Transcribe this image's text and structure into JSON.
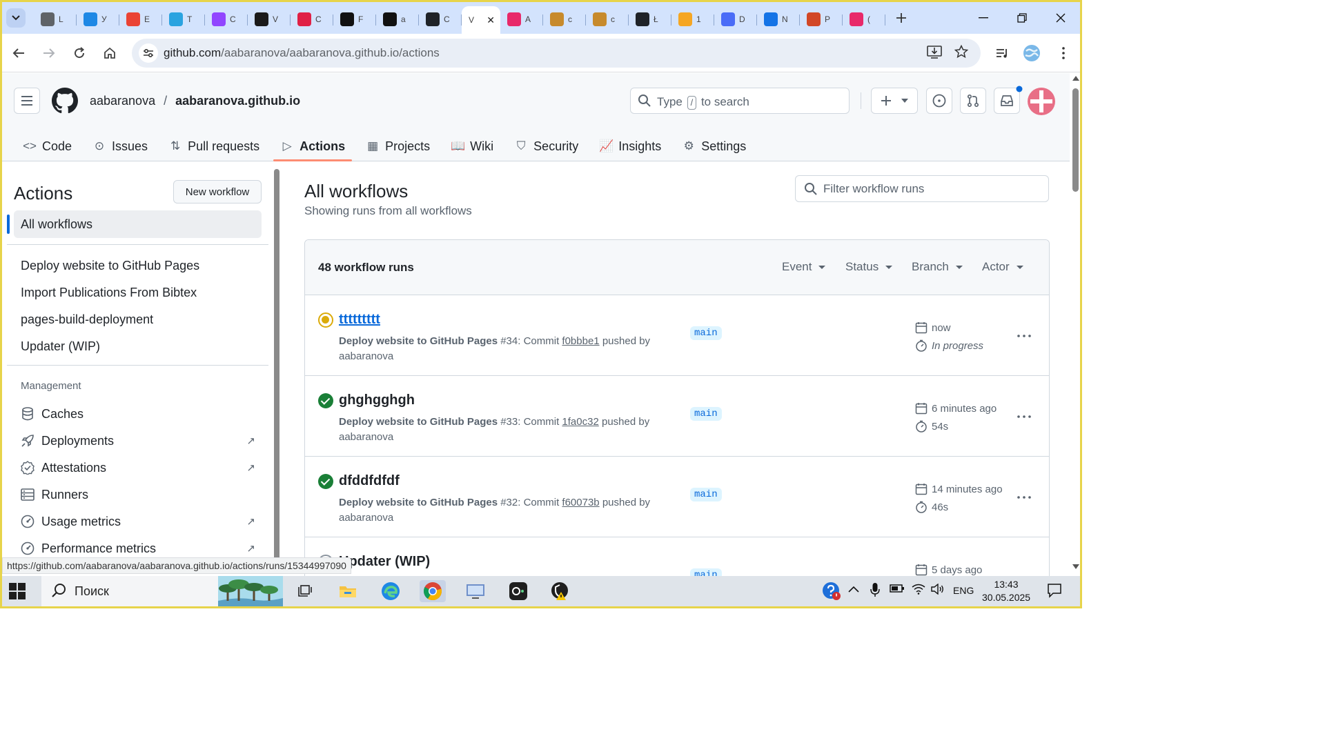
{
  "browser": {
    "active_tab_title": "V",
    "tab_menu_icon": "chevron-down-icon",
    "tabs": [
      {
        "short": "L",
        "color": "#5f6368",
        "icon": "chromium-icon"
      },
      {
        "short": "У",
        "color": "#1e88e5",
        "icon": "skype-icon"
      },
      {
        "short": "E",
        "color": "#ea4335",
        "icon": "gmail-icon"
      },
      {
        "short": "T",
        "color": "#2aa3e0",
        "icon": "telegram-icon"
      },
      {
        "short": "С",
        "color": "#9146ff",
        "icon": "twitch-icon"
      },
      {
        "short": "V",
        "color": "#1a1a1a",
        "icon": "r-icon"
      },
      {
        "short": "С",
        "color": "#e02046",
        "icon": "s-icon"
      },
      {
        "short": "F",
        "color": "#111111",
        "icon": "notion-icon"
      },
      {
        "short": "a",
        "color": "#111111",
        "icon": "notion-icon"
      },
      {
        "short": "С",
        "color": "#1f2328",
        "icon": "github-icon"
      }
    ],
    "tabs_after": [
      {
        "short": "A",
        "color": "#e8296a",
        "icon": "h-icon"
      },
      {
        "short": "с",
        "color": "#c78a2c",
        "icon": "bird-icon"
      },
      {
        "short": "с",
        "color": "#c78a2c",
        "icon": "bird-icon"
      },
      {
        "short": "Ł",
        "color": "#1f2328",
        "icon": "github-icon"
      },
      {
        "short": "1",
        "color": "#f5a623",
        "icon": "mail-icon"
      },
      {
        "short": "D",
        "color": "#4a6cf7",
        "icon": "doc-icon"
      },
      {
        "short": "N",
        "color": "#1473e6",
        "icon": "cloud-icon"
      },
      {
        "short": "P",
        "color": "#d24726",
        "icon": "powerpoint-icon"
      },
      {
        "short": "(",
        "color": "#e8296a",
        "icon": "h-icon"
      }
    ],
    "url_host": "github.com",
    "url_path": "/aabaranova/aabaranova.github.io/actions",
    "status_url": "https://github.com/aabaranova/aabaranova.github.io/actions/runs/15344997090"
  },
  "github": {
    "owner": "aabaranova",
    "separator": "/",
    "repo": "aabaranova.github.io",
    "search_prefix": "Type",
    "search_key": "/",
    "search_suffix": "to search",
    "nav": [
      {
        "label": "Code",
        "icon": "code-icon",
        "glyph": "<>"
      },
      {
        "label": "Issues",
        "icon": "issue-icon",
        "glyph": "⊙"
      },
      {
        "label": "Pull requests",
        "icon": "pull-request-icon",
        "glyph": "⇅"
      },
      {
        "label": "Actions",
        "icon": "play-icon",
        "glyph": "▷",
        "selected": true
      },
      {
        "label": "Projects",
        "icon": "table-icon",
        "glyph": "▦"
      },
      {
        "label": "Wiki",
        "icon": "book-icon",
        "glyph": "📖"
      },
      {
        "label": "Security",
        "icon": "shield-icon",
        "glyph": "⛉"
      },
      {
        "label": "Insights",
        "icon": "graph-icon",
        "glyph": "📈"
      },
      {
        "label": "Settings",
        "icon": "gear-icon",
        "glyph": "⚙"
      }
    ]
  },
  "sidebar": {
    "title": "Actions",
    "new_workflow": "New workflow",
    "all_workflows": "All workflows",
    "workflows": [
      "Deploy website to GitHub Pages",
      "Import Publications From Bibtex",
      "pages-build-deployment",
      "Updater (WIP)"
    ],
    "management_title": "Management",
    "management": [
      {
        "label": "Caches",
        "icon": "database-icon",
        "external": false
      },
      {
        "label": "Deployments",
        "icon": "rocket-icon",
        "external": true
      },
      {
        "label": "Attestations",
        "icon": "verified-icon",
        "external": true
      },
      {
        "label": "Runners",
        "icon": "server-icon",
        "external": false
      },
      {
        "label": "Usage metrics",
        "icon": "meter-icon",
        "external": true
      },
      {
        "label": "Performance metrics",
        "icon": "meter-icon",
        "external": true
      }
    ]
  },
  "main": {
    "title": "All workflows",
    "subtitle": "Showing runs from all workflows",
    "filter_placeholder": "Filter workflow runs",
    "runs_count": "48 workflow runs",
    "filters": [
      "Event",
      "Status",
      "Branch",
      "Actor"
    ],
    "runs": [
      {
        "title": "ttttttttt",
        "status": "in-progress",
        "workflow": "Deploy website to GitHub Pages",
        "number": "#34",
        "commit_prefix": ": Commit",
        "commit": "f0bbbe1",
        "pushed": "pushed by",
        "actor": "aabaranova",
        "branch": "main",
        "when": "now",
        "duration": "In progress"
      },
      {
        "title": "ghghgghgh",
        "status": "success",
        "workflow": "Deploy website to GitHub Pages",
        "number": "#33",
        "commit_prefix": ": Commit",
        "commit": "1fa0c32",
        "pushed": "pushed by",
        "actor": "aabaranova",
        "branch": "main",
        "when": "6 minutes ago",
        "duration": "54s"
      },
      {
        "title": "dfddfdfdf",
        "status": "success",
        "workflow": "Deploy website to GitHub Pages",
        "number": "#32",
        "commit_prefix": ": Commit",
        "commit": "f60073b",
        "pushed": "pushed by",
        "actor": "aabaranova",
        "branch": "main",
        "when": "14 minutes ago",
        "duration": "46s"
      },
      {
        "title": "Updater (WIP)",
        "status": "queued",
        "workflow": "",
        "number": "",
        "commit_prefix": "",
        "commit": "",
        "pushed": "",
        "actor": "",
        "branch": "main",
        "when": "5 days ago",
        "duration": ""
      }
    ]
  },
  "taskbar": {
    "search_label": "Поиск",
    "language": "ENG",
    "time": "13:43",
    "date": "30.05.2025"
  }
}
